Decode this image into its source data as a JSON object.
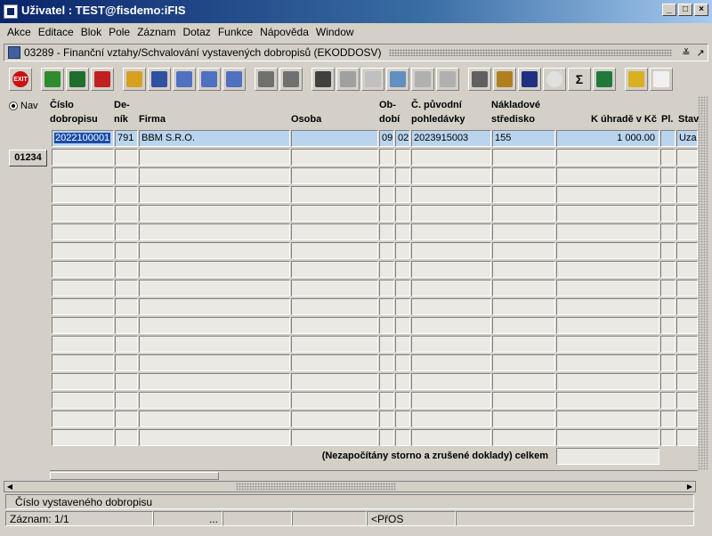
{
  "window": {
    "title": "Uživatel : TEST@fisdemo:iFIS",
    "min": "_",
    "max": "□",
    "close": "×"
  },
  "menu": [
    "Akce",
    "Editace",
    "Blok",
    "Pole",
    "Záznam",
    "Dotaz",
    "Funkce",
    "Nápověda",
    "Window"
  ],
  "form": {
    "title": "03289 - Finanční vztahy/Schvalování vystavených dobropisů (EKODDOSV)",
    "ctl1": "≚",
    "ctl2": "↗"
  },
  "toolbar": {
    "exit_label": "EXIT",
    "icons": [
      "insert-record-icon",
      "save-icon",
      "delete-record-icon",
      "query-icon",
      "execute-query-icon",
      "sort-asc-icon",
      "sort-desc-icon",
      "sort-custom-icon",
      "print-icon",
      "print-preview-icon",
      "cut-icon",
      "copy-icon",
      "paste-icon",
      "find-icon",
      "list-icon",
      "columns-icon",
      "calculator-icon",
      "settings-icon",
      "alert-icon",
      "clock-icon",
      "sum-icon",
      "excel-icon",
      "help-icon",
      "info-icon"
    ]
  },
  "nav": {
    "radio_label": "Nav",
    "record_button": "01234"
  },
  "columns": {
    "cislo": "Číslo dobropisu",
    "denik": "De- ník",
    "firma": "Firma",
    "osoba": "Osoba",
    "obdobi": "Ob- dobí",
    "puvodni": "Č. původní pohledávky",
    "stredisko": "Nákladové středisko",
    "uhrada": "K úhradě v Kč",
    "pl": "Pl.",
    "stav": "Stav"
  },
  "rows": [
    {
      "cislo": "2022100001",
      "denik": "791",
      "firma": "BBM S.R.O.",
      "osoba": "",
      "obdobi_m": "09",
      "obdobi_r": "02",
      "puvodni": "2023915003",
      "stredisko": "155",
      "uhrada": "1 000.00",
      "pl": "",
      "stav": "Uza"
    }
  ],
  "total_label": "(Nezapočítány storno a zrušené doklady) celkem",
  "status": {
    "hint": "Číslo vystaveného dobropisu",
    "record": "Záznam: 1/1",
    "seg2": "...",
    "mode": "<PřOS"
  }
}
